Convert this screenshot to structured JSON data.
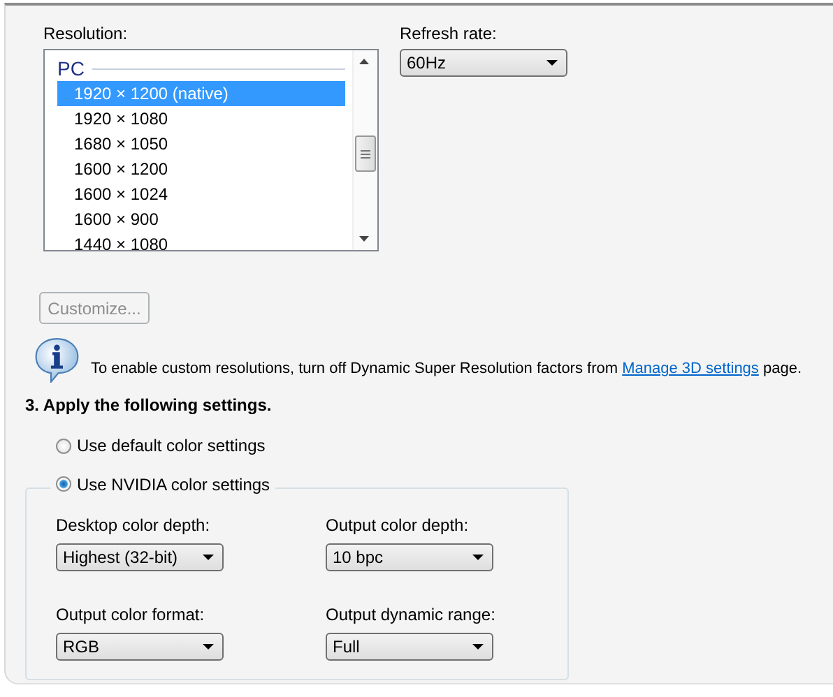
{
  "resolution": {
    "label": "Resolution:",
    "group": "PC",
    "items": [
      {
        "text": "1920 × 1200 (native)",
        "selected": true
      },
      {
        "text": "1920 × 1080",
        "selected": false
      },
      {
        "text": "1680 × 1050",
        "selected": false
      },
      {
        "text": "1600 × 1200",
        "selected": false
      },
      {
        "text": "1600 × 1024",
        "selected": false
      },
      {
        "text": "1600 × 900",
        "selected": false
      },
      {
        "text": "1440 × 1080",
        "selected": false
      }
    ]
  },
  "refresh_rate": {
    "label": "Refresh rate:",
    "value": "60Hz"
  },
  "customize_button": {
    "label": "Customize...",
    "disabled": true
  },
  "info": {
    "before": "To enable custom resolutions, turn off Dynamic Super Resolution factors from ",
    "link": "Manage 3D settings",
    "after": " page."
  },
  "section_title": "3. Apply the following settings.",
  "color_modes": [
    {
      "label": "Use default color settings",
      "selected": false
    },
    {
      "label": "Use NVIDIA color settings",
      "selected": true
    }
  ],
  "color_settings": [
    {
      "label": "Desktop color depth:",
      "value": "Highest (32-bit)"
    },
    {
      "label": "Output color depth:",
      "value": "10 bpc"
    },
    {
      "label": "Output color format:",
      "value": "RGB"
    },
    {
      "label": "Output dynamic range:",
      "value": "Full"
    }
  ]
}
